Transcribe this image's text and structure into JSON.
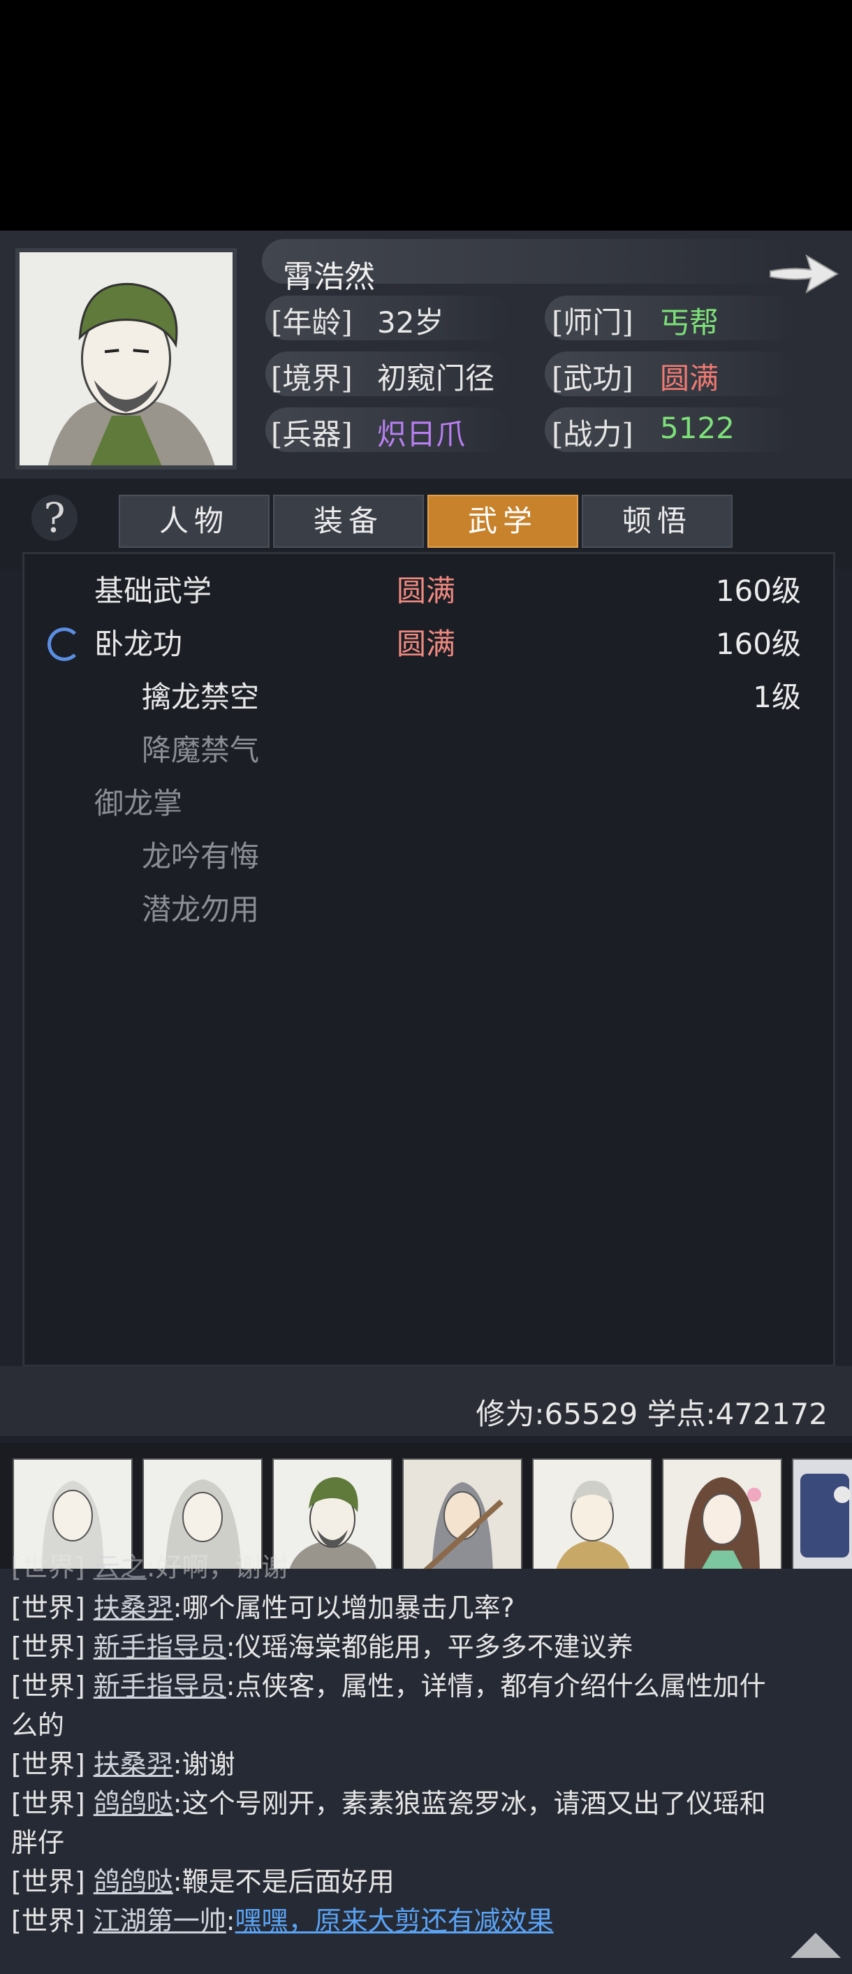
{
  "character": {
    "name": "霄浩然",
    "attrs": {
      "age_label": "[年龄]",
      "age_value": "32岁",
      "sect_label": "[师门]",
      "sect_value": "丐帮",
      "realm_label": "[境界]",
      "realm_value": "初窥门径",
      "martial_label": "[武功]",
      "martial_value": "圆满",
      "weapon_label": "[兵器]",
      "weapon_value": "炽日爪",
      "power_label": "[战力]",
      "power_value": "5122"
    }
  },
  "tabs": {
    "help": "?",
    "items": [
      "人物",
      "装备",
      "武学",
      "顿悟"
    ],
    "active": "武学"
  },
  "skills": [
    {
      "name": "基础武学",
      "status": "圆满",
      "level": "160级"
    },
    {
      "name": "卧龙功",
      "status": "圆满",
      "level": "160级"
    },
    {
      "name": "擒龙禁空",
      "status": "",
      "level": "1级"
    },
    {
      "name": "降魔禁气",
      "status": "",
      "level": ""
    },
    {
      "name": "御龙掌",
      "status": "",
      "level": ""
    },
    {
      "name": "龙吟有悔",
      "status": "",
      "level": ""
    },
    {
      "name": "潜龙勿用",
      "status": "",
      "level": ""
    }
  ],
  "stats": {
    "text": "修为:65529 学点:472172"
  },
  "chat": {
    "tag": "[世界]",
    "lines": [
      {
        "who": "云之",
        "text": ":好啊，谢谢"
      },
      {
        "who": "扶桑羿",
        "text": ":哪个属性可以增加暴击几率?"
      },
      {
        "who": "新手指导员",
        "text": ":仪瑶海棠都能用，平多多不建议养"
      },
      {
        "who": "新手指导员",
        "text": ":点侠客，属性，详情，都有介绍什么属性加什",
        "cont": "么的"
      },
      {
        "who": "扶桑羿",
        "text": ":谢谢"
      },
      {
        "who": "鸽鸽哒",
        "text": ":这个号刚开，素素狼蓝瓷罗冰，请酒又出了仪瑶和",
        "cont": "胖仔"
      },
      {
        "who": "鸽鸽哒",
        "text": ":鞭是不是后面好用"
      },
      {
        "who": "江湖第一帅",
        "text": ":",
        "link": "嘿嘿，原来大剪还有减效果"
      }
    ]
  },
  "colors": {
    "accent_tab": "#c9822c",
    "green": "#7ee07a",
    "red": "#f07a72",
    "purple": "#b77ff0",
    "link": "#5aa3f5"
  }
}
